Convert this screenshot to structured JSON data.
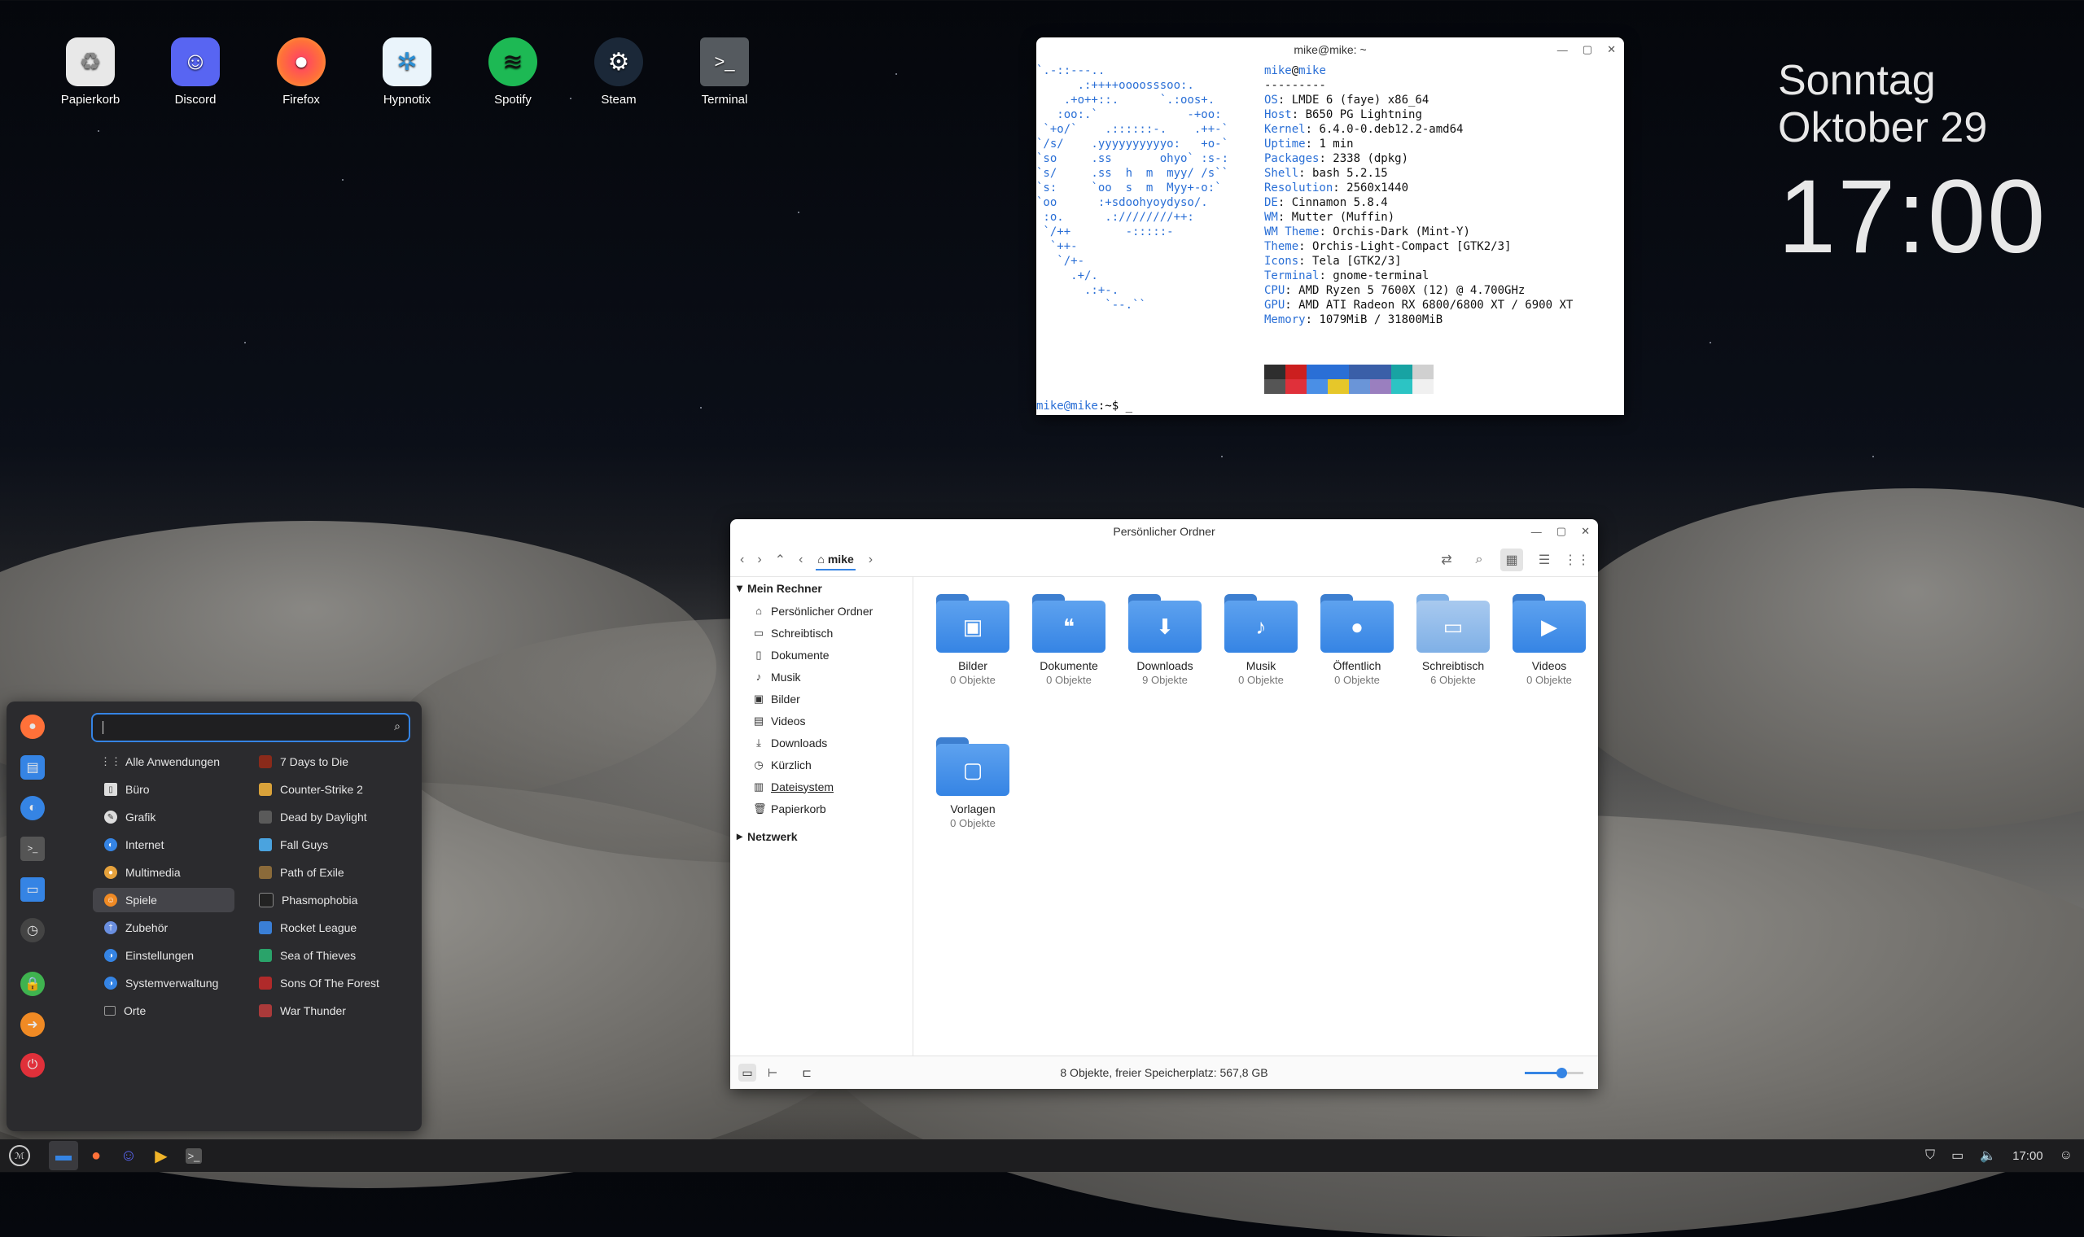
{
  "desktop": {
    "icons": [
      {
        "label": "Papierkorb",
        "icon": "trash-icon",
        "color": "#e8e8e8"
      },
      {
        "label": "Discord",
        "icon": "discord-icon",
        "color": "#5865f2"
      },
      {
        "label": "Firefox",
        "icon": "firefox-icon",
        "color": "#ff7139"
      },
      {
        "label": "Hypnotix",
        "icon": "hypnotix-icon",
        "color": "#4aa3df"
      },
      {
        "label": "Spotify",
        "icon": "spotify-icon",
        "color": "#1db954"
      },
      {
        "label": "Steam",
        "icon": "steam-icon",
        "color": "#1b2838"
      },
      {
        "label": "Terminal",
        "icon": "terminal-icon",
        "color": "#555a5f"
      }
    ],
    "clock": {
      "weekday": "Sonntag",
      "date": "Oktober 29",
      "time": "17:00"
    }
  },
  "terminal": {
    "title": "mike@mike: ~",
    "user_host_user": "mike",
    "user_host_host": "mike",
    "separator": "---------",
    "info": [
      {
        "key": "OS",
        "value": "LMDE 6 (faye) x86_64"
      },
      {
        "key": "Host",
        "value": "B650 PG Lightning"
      },
      {
        "key": "Kernel",
        "value": "6.4.0-0.deb12.2-amd64"
      },
      {
        "key": "Uptime",
        "value": "1 min"
      },
      {
        "key": "Packages",
        "value": "2338 (dpkg)"
      },
      {
        "key": "Shell",
        "value": "bash 5.2.15"
      },
      {
        "key": "Resolution",
        "value": "2560x1440"
      },
      {
        "key": "DE",
        "value": "Cinnamon 5.8.4"
      },
      {
        "key": "WM",
        "value": "Mutter (Muffin)"
      },
      {
        "key": "WM Theme",
        "value": "Orchis-Dark (Mint-Y)"
      },
      {
        "key": "Theme",
        "value": "Orchis-Light-Compact [GTK2/3]"
      },
      {
        "key": "Icons",
        "value": "Tela [GTK2/3]"
      },
      {
        "key": "Terminal",
        "value": "gnome-terminal"
      },
      {
        "key": "CPU",
        "value": "AMD Ryzen 5 7600X (12) @ 4.700GHz"
      },
      {
        "key": "GPU",
        "value": "AMD ATI Radeon RX 6800/6800 XT / 6900 XT"
      },
      {
        "key": "Memory",
        "value": "1079MiB / 31800MiB"
      }
    ],
    "palette_top": [
      "#2e2e2e",
      "#cc1f1f",
      "#2a6fd6",
      "#2a6fd6",
      "#3a5fa8",
      "#3a5fa8",
      "#18a3a3",
      "#d0d0d0"
    ],
    "palette_bottom": [
      "#555555",
      "#e0303a",
      "#4a8fe6",
      "#e6c72a",
      "#6a95d8",
      "#9a7fbf",
      "#2cc4c4",
      "#f0f0f0"
    ],
    "prompt_user": "mike@mike",
    "prompt_rest": ":~$ _"
  },
  "filemanager": {
    "title": "Persönlicher Ordner",
    "breadcrumb": "mike",
    "sidebar": {
      "computer_label": "Mein Rechner",
      "items": [
        {
          "label": "Persönlicher Ordner",
          "icon": "home-icon"
        },
        {
          "label": "Schreibtisch",
          "icon": "desktop-icon"
        },
        {
          "label": "Dokumente",
          "icon": "document-icon"
        },
        {
          "label": "Musik",
          "icon": "music-icon"
        },
        {
          "label": "Bilder",
          "icon": "image-icon"
        },
        {
          "label": "Videos",
          "icon": "video-icon"
        },
        {
          "label": "Downloads",
          "icon": "download-icon"
        },
        {
          "label": "Kürzlich",
          "icon": "clock-icon"
        },
        {
          "label": "Dateisystem",
          "icon": "drive-icon"
        },
        {
          "label": "Papierkorb",
          "icon": "trash-icon"
        }
      ],
      "network_label": "Netzwerk"
    },
    "folders": [
      {
        "name": "Bilder",
        "count": "0 Objekte",
        "glyph": "▣"
      },
      {
        "name": "Dokumente",
        "count": "0 Objekte",
        "glyph": "❝"
      },
      {
        "name": "Downloads",
        "count": "9 Objekte",
        "glyph": "⬇"
      },
      {
        "name": "Musik",
        "count": "0 Objekte",
        "glyph": "♪"
      },
      {
        "name": "Öffentlich",
        "count": "0 Objekte",
        "glyph": "●"
      },
      {
        "name": "Schreibtisch",
        "count": "6 Objekte",
        "glyph": "▭"
      },
      {
        "name": "Videos",
        "count": "0 Objekte",
        "glyph": "▶"
      },
      {
        "name": "Vorlagen",
        "count": "0 Objekte",
        "glyph": "▢"
      }
    ],
    "status": "8 Objekte, freier Speicherplatz: 567,8 GB",
    "zoom_level": 0.62
  },
  "menu": {
    "categories": [
      {
        "label": "Alle Anwendungen",
        "color": "#888888"
      },
      {
        "label": "Büro",
        "color": "#dddddd"
      },
      {
        "label": "Grafik",
        "color": "#dddddd"
      },
      {
        "label": "Internet",
        "color": "#3584e4"
      },
      {
        "label": "Multimedia",
        "color": "#e6a23c"
      },
      {
        "label": "Spiele",
        "color": "#f08a24"
      },
      {
        "label": "Zubehör",
        "color": "#6a8fe0"
      },
      {
        "label": "Einstellungen",
        "color": "#3584e4"
      },
      {
        "label": "Systemverwaltung",
        "color": "#3584e4"
      },
      {
        "label": "Orte",
        "color": "#999999"
      }
    ],
    "selected_category": "Spiele",
    "games": [
      {
        "label": "7 Days to Die",
        "color": "#8a2a1a"
      },
      {
        "label": "Counter-Strike 2",
        "color": "#d9a23a"
      },
      {
        "label": "Dead by Daylight",
        "color": "#5a5a5a"
      },
      {
        "label": "Fall Guys",
        "color": "#4aa3df"
      },
      {
        "label": "Path of Exile",
        "color": "#8a6a3a"
      },
      {
        "label": "Phasmophobia",
        "color": "#222222"
      },
      {
        "label": "Rocket League",
        "color": "#3a7fd6"
      },
      {
        "label": "Sea of Thieves",
        "color": "#2aa36a"
      },
      {
        "label": "Sons Of The Forest",
        "color": "#b02a2a"
      },
      {
        "label": "War Thunder",
        "color": "#aa3a3a"
      }
    ]
  },
  "taskbar": {
    "time": "17:00"
  }
}
